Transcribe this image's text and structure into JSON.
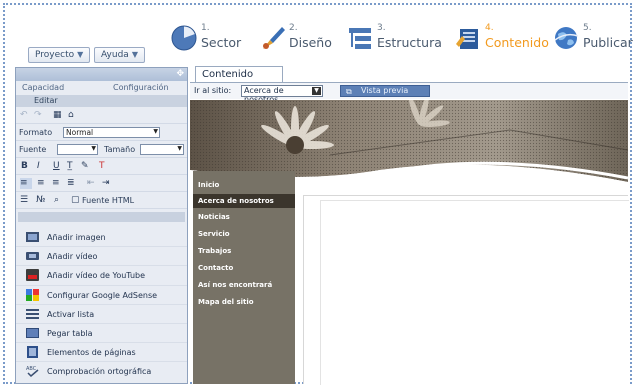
{
  "wizard": {
    "steps": [
      {
        "num": "1.",
        "label": "Sector",
        "icon": "pie-chart-icon",
        "active": false
      },
      {
        "num": "2.",
        "label": "Diseño",
        "icon": "paintbrush-icon",
        "active": false
      },
      {
        "num": "3.",
        "label": "Estructura",
        "icon": "structure-icon",
        "active": false
      },
      {
        "num": "4.",
        "label": "Contenido",
        "icon": "content-icon",
        "active": true
      },
      {
        "num": "5.",
        "label": "Publicar",
        "icon": "globe-icon",
        "active": false
      }
    ]
  },
  "menus": {
    "proyecto": "Proyecto",
    "ayuda": "Ayuda"
  },
  "panel": {
    "tabs": [
      "Capacidad",
      "Configuración"
    ],
    "edit_label": "Editar",
    "format_label": "Formato",
    "format_value": "Normal",
    "font_label": "Fuente",
    "size_label": "Tamaño",
    "source_html": "Fuente HTML",
    "actions": [
      {
        "label": "Añadir imagen",
        "icon": "image-icon"
      },
      {
        "label": "Añadir vídeo",
        "icon": "video-icon"
      },
      {
        "label": "Añadir vídeo de YouTube",
        "icon": "youtube-icon"
      },
      {
        "label": "Configurar Google AdSense",
        "icon": "adsense-icon"
      },
      {
        "label": "Activar lista",
        "icon": "list-icon"
      },
      {
        "label": "Pegar tabla",
        "icon": "table-icon"
      },
      {
        "label": "Elementos de páginas",
        "icon": "page-elements-icon"
      },
      {
        "label": "Comprobación ortográfica",
        "icon": "spellcheck-icon"
      }
    ]
  },
  "content": {
    "tab": "Contenido",
    "go_to_label": "Ir al sitio:",
    "site_value": "Acerca de nosotros",
    "preview": "Vista previa"
  },
  "site_nav": {
    "items": [
      "Inicio",
      "Acerca de nosotros",
      "Noticias",
      "Servicio",
      "Trabajos",
      "Contacto",
      "Así nos encontrará",
      "Mapa del sitio"
    ],
    "selected": "Acerca de nosotros"
  },
  "colors": {
    "accent": "#f29a1f",
    "nav_bg": "#777266",
    "nav_selected": "#3b352c"
  }
}
